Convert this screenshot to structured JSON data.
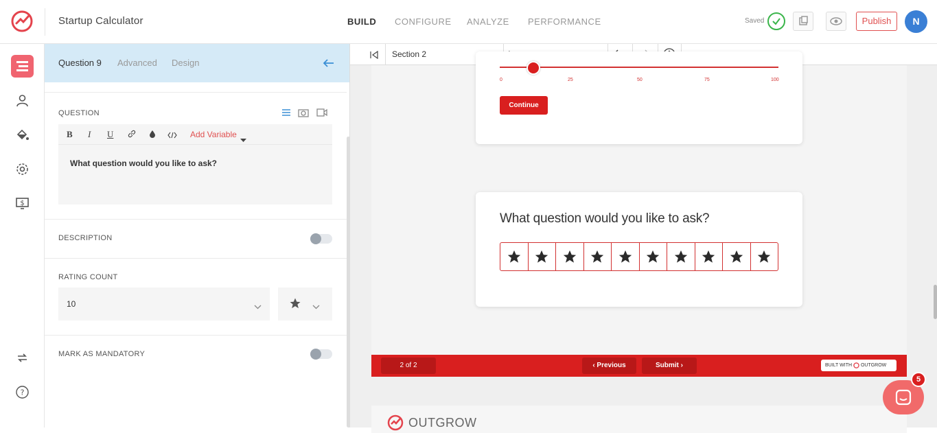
{
  "app": {
    "title": "Startup Calculator"
  },
  "nav": {
    "tabs": [
      "BUILD",
      "CONFIGURE",
      "ANALYZE",
      "PERFORMANCE"
    ],
    "active": "BUILD"
  },
  "header": {
    "saved_label": "Saved",
    "publish_label": "Publish",
    "avatar_initial": "N"
  },
  "colors": {
    "brand": "#d91f1f",
    "accent": "#f06470",
    "panel_header": "#d5eaf7",
    "saved_green": "#3ab54a",
    "avatar": "#3a7fd5"
  },
  "sidebar": {
    "items": [
      {
        "icon": "builder-icon",
        "active": true
      },
      {
        "icon": "user-icon",
        "active": false
      },
      {
        "icon": "paint-bucket-icon",
        "active": false
      },
      {
        "icon": "gear-icon",
        "active": false
      },
      {
        "icon": "dollar-screen-icon",
        "active": false
      },
      {
        "icon": "sync-icon",
        "active": false
      },
      {
        "icon": "help-icon",
        "active": false
      }
    ]
  },
  "panel": {
    "tabs": [
      "Question 9",
      "Advanced",
      "Design"
    ],
    "question": {
      "label": "QUESTION",
      "toolbar": {
        "bold": "B",
        "italic": "I",
        "underline": "U",
        "add_variable": "Add Variable"
      },
      "text": "What question would you like to ask?"
    },
    "description": {
      "label": "DESCRIPTION",
      "enabled": false
    },
    "rating_count": {
      "label": "RATING COUNT",
      "value": "10",
      "icon": "star-icon"
    },
    "mandatory": {
      "label": "MARK AS MANDATORY",
      "enabled": false
    }
  },
  "preview": {
    "section": "Section 2",
    "slider": {
      "ticks": [
        "0",
        "25",
        "50",
        "75",
        "100"
      ],
      "value": 12
    },
    "continue_label": "Continue",
    "rating_question": "What question would you like to ask?",
    "star_count": 10,
    "footer": {
      "page": "2 of 2",
      "previous": "Previous",
      "submit": "Submit",
      "built_with": "BUILT WITH",
      "built_with_brand": "OUTGROW"
    },
    "brand": "OUTGROW"
  },
  "chat": {
    "badge": "5"
  }
}
